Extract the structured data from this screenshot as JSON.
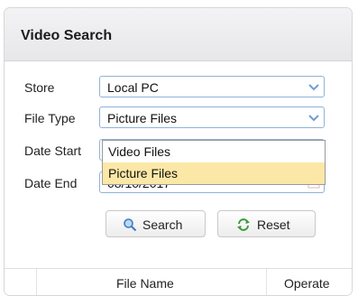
{
  "panel": {
    "title": "Video Search"
  },
  "form": {
    "store": {
      "label": "Store",
      "value": "Local PC"
    },
    "file_type": {
      "label": "File Type",
      "value": "Picture Files"
    },
    "date_start": {
      "label": "Date Start"
    },
    "date_end": {
      "label": "Date End",
      "value": "08/10/2017"
    }
  },
  "dropdown": {
    "options": [
      "Video Files",
      "Picture Files"
    ],
    "selected": "Picture Files"
  },
  "buttons": {
    "search": "Search",
    "reset": "Reset"
  },
  "table": {
    "columns": [
      "File Name",
      "Operate"
    ]
  },
  "colors": {
    "accent_border": "#8fb2d8",
    "highlight": "#fbe8a6"
  }
}
